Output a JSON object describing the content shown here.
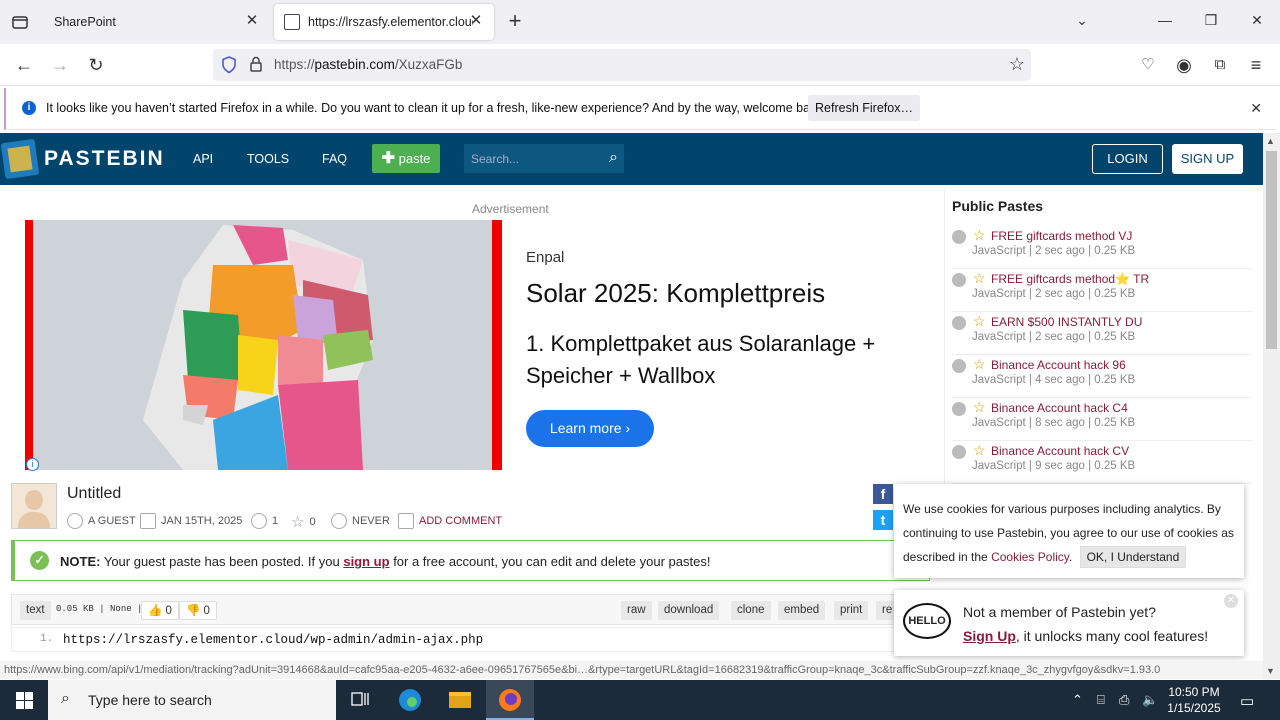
{
  "browser": {
    "tabs": [
      {
        "title": "SharePoint",
        "active": false
      },
      {
        "title": "https://lrszasfy.elementor.cloud",
        "active": true
      }
    ],
    "url_prefix": "https://",
    "url_domain": "pastebin.com",
    "url_path": "/XuzxaFGb",
    "notification": {
      "message": "It looks like you haven’t started Firefox in a while. Do you want to clean it up for a fresh, like-new experience? And by the way, welcome back!",
      "button": "Refresh Firefox…"
    },
    "status_url": "https://www.bing.com/api/v1/mediation/tracking?adUnit=3914668&auId=cafc95aa-e205-4632-a6ee-09651767565e&bi…&rtype=targetURL&tagId=16682319&trafficGroup=knaqe_3c&trafficSubGroup=zzf.knaqe_3c_zhygvfgoy&sdkv=1.93.0"
  },
  "pastebin": {
    "brand": "PASTEBIN",
    "nav": [
      "API",
      "TOOLS",
      "FAQ"
    ],
    "paste_button": "paste",
    "search_placeholder": "Search...",
    "login": "LOGIN",
    "signup": "SIGN UP"
  },
  "ad": {
    "label": "Advertisement",
    "brand": "Enpal",
    "headline": "Solar 2025: Komplettpreis",
    "text": "1. Komplettpaket aus Solaranlage + Speicher + Wallbox",
    "cta": "Learn more",
    "map_regions": [
      "Schleswig-Holstein",
      "Hamburg",
      "Mecklenburg-Vorpommern",
      "Bremen",
      "Lower Saxony",
      "Berlin",
      "Brandenburg",
      "Saxony-Anhalt",
      "North Rhine-Westphalia",
      "Thuringia",
      "Saxony",
      "Hesse",
      "Rhineland-Palatinate",
      "Saarland",
      "Baden-Württemberg",
      "Bavaria"
    ]
  },
  "paste": {
    "title": "Untitled",
    "author": "A GUEST",
    "date": "JAN 15TH, 2025",
    "views": "1",
    "stars": "0",
    "expiry": "NEVER",
    "add_comment": "ADD COMMENT",
    "note_label": "NOTE:",
    "note_pre": "Your guest paste has been posted. If you",
    "note_link": "sign up",
    "note_post": "for a free account, you can edit and delete your pastes!",
    "syntax": "text",
    "size": "0.05 KB",
    "category": "None",
    "likes": "0",
    "dislikes": "0",
    "actions": [
      "raw",
      "download",
      "clone",
      "embed",
      "print",
      "re"
    ],
    "line_number": "1.",
    "code": "https://lrszasfy.elementor.cloud/wp-admin/admin-ajax.php"
  },
  "public_pastes": {
    "title": "Public Pastes",
    "items": [
      {
        "name": "FREE giftcards method VJ",
        "meta": "JavaScript | 2 sec ago | 0.25 KB"
      },
      {
        "name": "FREE giftcards method⭐ TR",
        "meta": "JavaScript | 2 sec ago | 0.25 KB"
      },
      {
        "name": "EARN $500 INSTANTLY DU",
        "meta": "JavaScript | 2 sec ago | 0.25 KB"
      },
      {
        "name": "Binance Account hack 96",
        "meta": "JavaScript | 4 sec ago | 0.25 KB"
      },
      {
        "name": "Binance Account hack C4",
        "meta": "JavaScript | 8 sec ago | 0.25 KB"
      },
      {
        "name": "Binance Account hack CV",
        "meta": "JavaScript | 9 sec ago | 0.25 KB"
      }
    ]
  },
  "cookie": {
    "text": "We use cookies for various purposes including analytics. By continuing to use Pastebin, you agree to our use of cookies as described in the",
    "link": "Cookies Policy",
    "ok": "OK, I Understand"
  },
  "member": {
    "hello": "HELLO",
    "line1": "Not a member of Pastebin yet?",
    "link": "Sign Up",
    "line2": ", it unlocks many cool features!"
  },
  "taskbar": {
    "search_placeholder": "Type here to search",
    "time": "10:50 PM",
    "date": "1/15/2025"
  },
  "colors": {
    "pastebin_header": "#02456c",
    "paste_green": "#4caf50",
    "link_maroon": "#8a1c37",
    "ad_cta": "#1a73e8"
  }
}
